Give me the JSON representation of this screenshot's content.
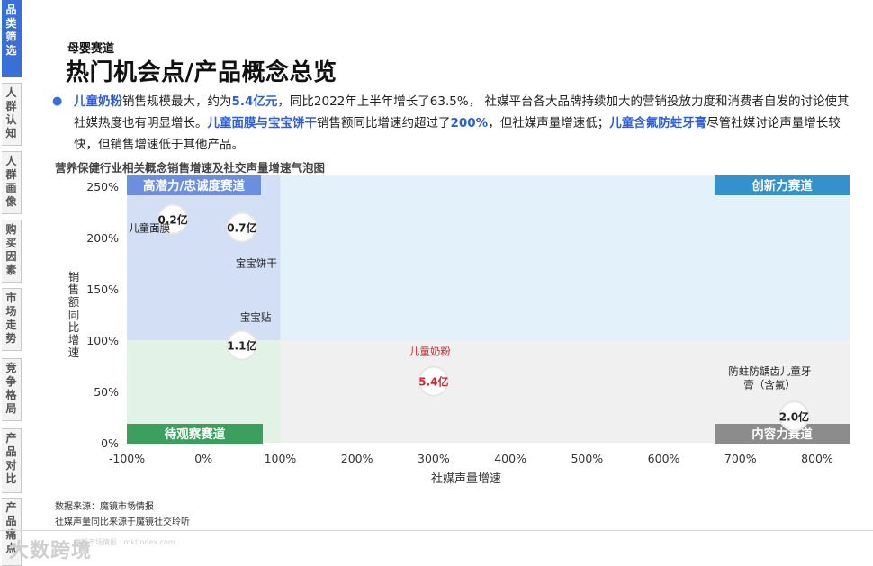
{
  "sidebar": {
    "tabs": [
      {
        "label": "品类筛选",
        "active": true
      },
      {
        "label": "人群认知",
        "active": false
      },
      {
        "label": "人群画像",
        "active": false
      },
      {
        "label": "购买因素",
        "active": false
      },
      {
        "label": "市场走势",
        "active": false
      },
      {
        "label": "竞争格局",
        "active": false
      },
      {
        "label": "产品对比",
        "active": false
      },
      {
        "label": "产品痛点",
        "active": false
      }
    ]
  },
  "header": {
    "subtitle": "母婴赛道",
    "title": "热门机会点/产品概念总览"
  },
  "summary": {
    "p1_hl": "儿童奶粉",
    "p2": "销售规模最大，约为",
    "p3_hl": "5.4亿元",
    "p4": "，同比2022年上半年增长了63.5%， 社媒平台各大品牌持续加大的营销投放力度和消费者自发的讨论使其社媒热度也有明显增长。",
    "p5_hl": "儿童面膜与宝宝饼干",
    "p6": "销售额同比增速约超过了",
    "p7_hl": "200%",
    "p8": "，但社媒声量增速低；",
    "p9_hl": "儿童含氟防蛀牙膏",
    "p10": "尽管社媒讨论声量增长较快，但销售增速低于其他产品。"
  },
  "chart_data": {
    "type": "scatter",
    "subtype": "bubble",
    "title": "营养保健行业相关概念销售增速及社交声量增速气泡图",
    "xlabel": "社媒声量增速",
    "ylabel": "销售额同比增速",
    "x_ticks": [
      "-100%",
      "0%",
      "100%",
      "200%",
      "300%",
      "400%",
      "500%",
      "600%",
      "700%",
      "800%"
    ],
    "y_ticks": [
      "0%",
      "50%",
      "100%",
      "150%",
      "200%",
      "250%"
    ],
    "xlim": [
      -100,
      800
    ],
    "ylim": [
      0,
      250
    ],
    "quadrant_split": {
      "x": 100,
      "y": 100
    },
    "quadrants": [
      {
        "label": "高潜力/忠诚度赛道",
        "position": "top-left",
        "fill": "#d2dff5",
        "label_bg": "#6b8fde"
      },
      {
        "label": "创新力赛道",
        "position": "top-right",
        "fill": "#e3f1fa",
        "label_bg": "#3591cc"
      },
      {
        "label": "待观察赛道",
        "position": "bottom-left",
        "fill": "#e2f2e6",
        "label_bg": "#3b9f5e"
      },
      {
        "label": "内容力赛道",
        "position": "bottom-right",
        "fill": "#f0f0f0",
        "label_bg": "#8c8c8c"
      }
    ],
    "points": [
      {
        "name": "儿童面膜",
        "x": -40,
        "y": 218,
        "sales": "0.2亿",
        "color": "#222222"
      },
      {
        "name": "宝宝饼干",
        "x": 50,
        "y": 210,
        "sales": "0.7亿",
        "color": "#222222"
      },
      {
        "name": "宝宝贴",
        "x": 50,
        "y": 95,
        "sales": "1.1亿",
        "color": "#222222"
      },
      {
        "name": "儿童奶粉",
        "x": 300,
        "y": 60,
        "sales": "5.4亿",
        "color": "#d9232d"
      },
      {
        "name": "防蛀防龋齿儿童牙膏（含氟）",
        "x": 770,
        "y": 26,
        "sales": "2.0亿",
        "color": "#222222"
      }
    ],
    "point_labels": {
      "儿童面膜": "儿童面膜",
      "宝宝饼干": "宝宝饼干",
      "宝宝贴": "宝宝贴",
      "儿童奶粉": "儿童奶粉",
      "toothpaste_line1": "防蛀防龋齿儿童牙",
      "toothpaste_line2": "膏（含氟）"
    }
  },
  "footer": {
    "source1": "数据来源：魔镜市场情报",
    "source2": "社媒声量同比来源于魔镜社交聆听",
    "watermark": "大数跨境",
    "watermark_url": "魔镜市场情报 · mktindex.com"
  }
}
